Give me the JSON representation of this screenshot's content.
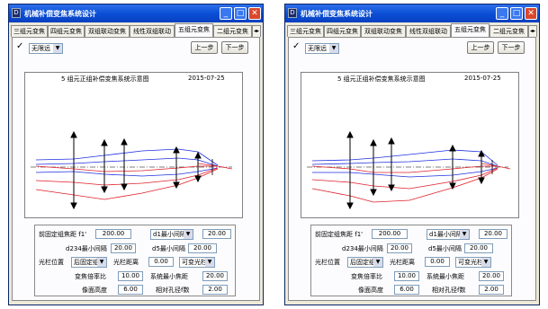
{
  "window": {
    "title": "机械补偿变焦系统设计",
    "icon_label": "D",
    "min_icon": "minimize-icon",
    "max_icon": "maximize-icon",
    "close_icon": "close-icon"
  },
  "tabs": [
    "三组元变焦",
    "四组元变焦",
    "双组联动变焦",
    "线性双组联动",
    "五组元变焦",
    "二组元变焦"
  ],
  "active_tab": "五组元变焦",
  "toolbar": {
    "check_icon": "checkmark-icon",
    "mode_value": "无限远",
    "prev_label": "上一步",
    "next_label": "下一步"
  },
  "diagram": {
    "title": "5 组元正组补偿变焦系统示意图",
    "date": "2015-07-25",
    "colors": {
      "axis": "#000000",
      "ray_blue": "#1f2fe0",
      "ray_red": "#e0202a"
    }
  },
  "params": {
    "front_focal_label": "前固定组焦距 f1'",
    "front_focal_value": "200.00",
    "min_gap_select": "d1最小间隔",
    "min_gap_value": "20.00",
    "d234_label": "d234最小间隔",
    "d234_value": "20.00",
    "d5_label": "d5最小间隔",
    "d5_value": "20.00",
    "stop_pos_label": "光栏位置",
    "stop_pos_value": "后固定组",
    "stop_dist_label": "光栏距离",
    "stop_dist_value": "0.00",
    "stop_type_value": "可变光栏",
    "zoom_ratio_label": "变焦倍率比",
    "zoom_ratio_value": "10.00",
    "min_focal_label": "系统最小焦距",
    "min_focal_value": "20.00",
    "image_height_label": "像面高度",
    "image_height_value": "6.00",
    "f_number_label": "相对孔径f数",
    "f_number_value": "2.00"
  }
}
